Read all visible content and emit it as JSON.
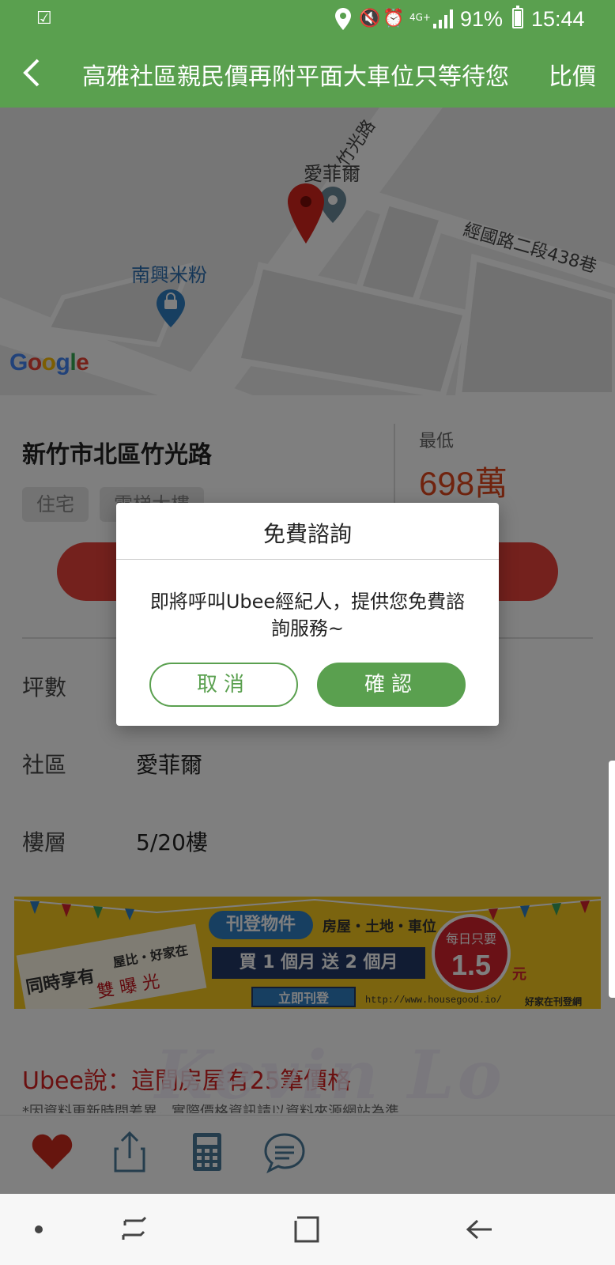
{
  "status_bar": {
    "battery": "91%",
    "time": "15:44",
    "network": "4G+"
  },
  "app_bar": {
    "title": "高雅社區親民價再附平面大車位只等待您",
    "action": "比價"
  },
  "map": {
    "roads": [
      "竹光路",
      "經國路二段438巷"
    ],
    "places": [
      "愛菲爾",
      "南興米粉"
    ],
    "google": [
      "G",
      "o",
      "o",
      "g",
      "l",
      "e"
    ]
  },
  "listing": {
    "address": "新竹市北區竹光路",
    "tags": [
      "住宅",
      "電梯大樓"
    ],
    "price_label": "最低",
    "price": "698萬",
    "details": [
      {
        "label": "坪數",
        "value": ""
      },
      {
        "label": "社區",
        "value": "愛菲爾"
      },
      {
        "label": "樓層",
        "value": "5/20樓"
      }
    ]
  },
  "banner": {
    "left_title": "同時享有",
    "left_sub": "屋比・好家在",
    "left_boxes": "雙 曝 光",
    "pill": "刊登物件",
    "types": "房屋・土地・車位",
    "offer": "買 1 個月  送 2 個月",
    "cta": "立即刊登",
    "badge_line1": "每日只要",
    "badge_value": "1.5",
    "badge_unit": "元",
    "url": "http://www.housegood.io/",
    "brand": "好家在刊登網"
  },
  "ubee": {
    "headline": "Ubee說：這間房屋有25筆價格",
    "note": "*因資料更新時間差異，實際價格資訊請以資料來源網站為準"
  },
  "watermark": "Kevin Lo",
  "dialog": {
    "title": "免費諮詢",
    "message": "即將呼叫Ubee經紀人，提供您免費諮詢服務~",
    "cancel": "取消",
    "confirm": "確認"
  },
  "colors": {
    "primary": "#5aa04f",
    "price": "#e0471c",
    "call_button": "#e8433b",
    "favorite": "#cc2a1c"
  }
}
